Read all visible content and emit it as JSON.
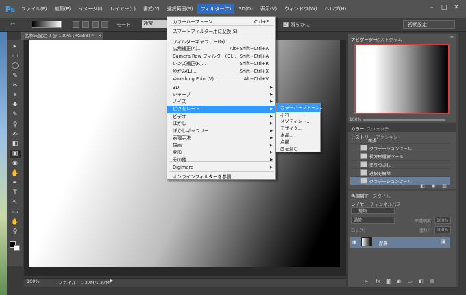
{
  "menubar": {
    "logo": "Ps",
    "items": [
      "ファイル(F)",
      "編集(E)",
      "イメージ(I)",
      "レイヤー(L)",
      "書式(Y)",
      "選択範囲(S)",
      "フィルター(T)",
      "3D(D)",
      "表示(V)",
      "ウィンドウ(W)",
      "ヘルプ(H)"
    ],
    "active_index": 6,
    "window_controls": [
      "–",
      "□",
      "✕"
    ]
  },
  "options": {
    "mode_label": "モード：",
    "mode_value": "通常",
    "antialias_label": "滑らかに",
    "antialias_check": "✓",
    "workspace": "初期設定"
  },
  "document": {
    "tab_title": "名称未設定 2 @ 100% (RGB/8) *",
    "tab_close": "×",
    "zoom": "100%",
    "file_info": "ファイル：1.37M/1.37M",
    "status_arrow": "▶"
  },
  "filter_menu": {
    "items": [
      {
        "label": "カラーハーフトーン",
        "shortcut": "Ctrl+F"
      },
      {
        "label": "スマートフィルター用に変換(S)",
        "shortcut": ""
      },
      {
        "label": "フィルターギャラリー(G)...",
        "shortcut": ""
      },
      {
        "label": "広角補正(A)...",
        "shortcut": "Alt+Shift+Ctrl+A"
      },
      {
        "label": "Camera Raw フィルター(C)...",
        "shortcut": "Shift+Ctrl+A"
      },
      {
        "label": "レンズ補正(R)...",
        "shortcut": "Shift+Ctrl+R"
      },
      {
        "label": "ゆがみ(L)...",
        "shortcut": "Shift+Ctrl+X"
      },
      {
        "label": "Vanishing Point(V)...",
        "shortcut": "Alt+Ctrl+V"
      },
      {
        "label": "3D",
        "shortcut": ""
      },
      {
        "label": "シャープ",
        "shortcut": ""
      },
      {
        "label": "ノイズ",
        "shortcut": ""
      },
      {
        "label": "ピクセレート",
        "shortcut": ""
      },
      {
        "label": "ビデオ",
        "shortcut": ""
      },
      {
        "label": "ぼかし",
        "shortcut": ""
      },
      {
        "label": "ぼかしギャラリー",
        "shortcut": ""
      },
      {
        "label": "表現手法",
        "shortcut": ""
      },
      {
        "label": "描画",
        "shortcut": ""
      },
      {
        "label": "変形",
        "shortcut": ""
      },
      {
        "label": "その他",
        "shortcut": ""
      },
      {
        "label": "Digimarc",
        "shortcut": ""
      },
      {
        "label": "オンラインフィルターを参照...",
        "shortcut": ""
      }
    ],
    "submenu_arrow": "▶"
  },
  "pixelate_submenu": {
    "items": [
      "カラーハーフトーン...",
      "ぶれ",
      "メゾティント...",
      "モザイク...",
      "水晶...",
      "点描...",
      "面を刻む"
    ]
  },
  "panels": {
    "navigator_tabs": [
      "ナビゲーター",
      "ヒストグラム"
    ],
    "nav_zoom": "100%",
    "color_tabs": [
      "カラー",
      "スウォッチ"
    ],
    "history_tabs": [
      "ヒストリー",
      "アクション"
    ],
    "history_items": [
      "新規",
      "グラデーションツール",
      "長方形選択ツール",
      "塗りつぶし",
      "選択を解除",
      "グラデーションツール"
    ],
    "layers_header_tabs": [
      "色調補正",
      "スタイル"
    ],
    "layers_tabs": [
      "レイヤー",
      "チャンネル",
      "パス"
    ],
    "layer_filter": "種類",
    "blend_mode": "通常",
    "opacity_label": "不透明度：",
    "opacity_value": "100%",
    "lock_label": "ロック：",
    "fill_label": "塗り：",
    "fill_value": "100%",
    "layer_name": "背景",
    "panel_icons": [
      "»",
      "≡"
    ]
  },
  "tools": [
    "▸",
    "⬚",
    "◯",
    "✎",
    "✂",
    "⌖",
    "✚",
    "✎",
    "⚲",
    "✍",
    "◧",
    "▣",
    "◉",
    "✋",
    "✒",
    "T",
    "↖",
    "▭",
    "✋",
    "⚲"
  ]
}
